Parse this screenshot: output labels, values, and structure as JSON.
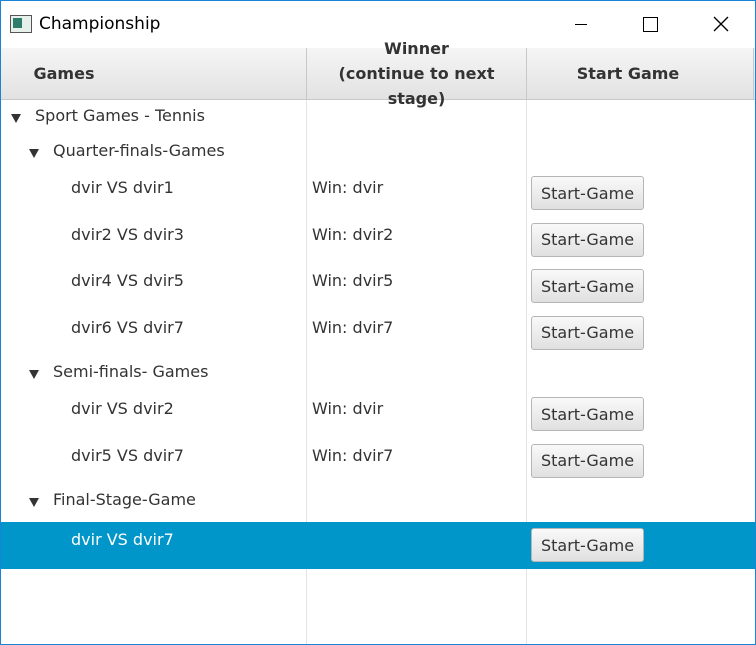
{
  "window": {
    "title": "Championship",
    "icon": "app-window-icon"
  },
  "table": {
    "columns": [
      {
        "label": "Games"
      },
      {
        "label_line1": "Winner",
        "label_line2": "(continue to next stage)"
      },
      {
        "label": "Start Game"
      }
    ],
    "rows": [
      {
        "level": 0,
        "expanded": true,
        "game": "Sport Games - Tennis"
      },
      {
        "level": 1,
        "expanded": true,
        "game": "Quarter-finals-Games"
      },
      {
        "level": 2,
        "game": "dvir VS dvir1",
        "winner": "Win: dvir",
        "button": "Start-Game"
      },
      {
        "level": 2,
        "game": "dvir2 VS dvir3",
        "winner": "Win: dvir2",
        "button": "Start-Game"
      },
      {
        "level": 2,
        "game": "dvir4 VS dvir5",
        "winner": "Win: dvir5",
        "button": "Start-Game"
      },
      {
        "level": 2,
        "game": "dvir6 VS dvir7",
        "winner": "Win: dvir7",
        "button": "Start-Game"
      },
      {
        "level": 1,
        "expanded": true,
        "game": "Semi-finals- Games"
      },
      {
        "level": 2,
        "game": "dvir VS dvir2",
        "winner": "Win: dvir",
        "button": "Start-Game"
      },
      {
        "level": 2,
        "game": "dvir5 VS dvir7",
        "winner": "Win: dvir7",
        "button": "Start-Game"
      },
      {
        "level": 1,
        "expanded": true,
        "game": "Final-Stage-Game"
      },
      {
        "level": 2,
        "game": "dvir VS dvir7",
        "winner": "",
        "button": "Start-Game",
        "selected": true
      }
    ]
  },
  "colors": {
    "selection": "#0096c9",
    "window_border": "#1883d7"
  }
}
